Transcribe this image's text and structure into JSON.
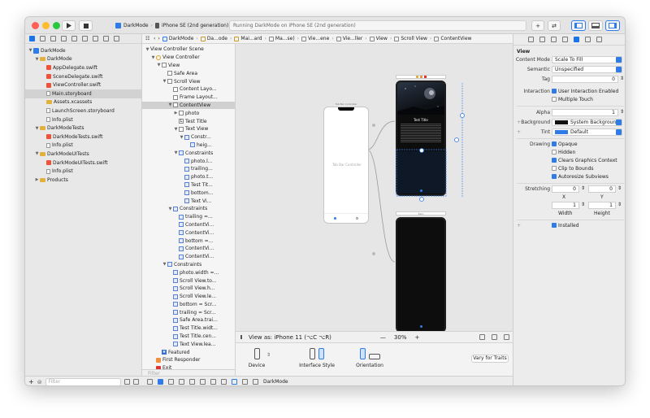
{
  "toolbar": {
    "scheme_name": "DarkMode",
    "destination": "iPhone SE (2nd generation)",
    "activity_text": "Running DarkMode on iPhone SE (2nd generation)",
    "run_icon": "play-icon",
    "stop_icon": "stop-icon",
    "traffic_light_colors": [
      "#ff5f57",
      "#febc2e",
      "#28c840"
    ]
  },
  "navigator": {
    "items": [
      {
        "label": "DarkMode",
        "kind": "project",
        "indent": 0,
        "disclosure": "open"
      },
      {
        "label": "DarkMode",
        "kind": "folder",
        "indent": 1,
        "disclosure": "open"
      },
      {
        "label": "AppDelegate.swift",
        "kind": "swift",
        "indent": 2
      },
      {
        "label": "SceneDelegate.swift",
        "kind": "swift",
        "indent": 2
      },
      {
        "label": "ViewController.swift",
        "kind": "swift",
        "indent": 2
      },
      {
        "label": "Main.storyboard",
        "kind": "file",
        "indent": 2,
        "selected": true
      },
      {
        "label": "Assets.xcassets",
        "kind": "folder",
        "indent": 2
      },
      {
        "label": "LaunchScreen.storyboard",
        "kind": "file",
        "indent": 2
      },
      {
        "label": "Info.plist",
        "kind": "file",
        "indent": 2
      },
      {
        "label": "DarkModeTests",
        "kind": "folder",
        "indent": 1,
        "disclosure": "open"
      },
      {
        "label": "DarkModeTests.swift",
        "kind": "swift",
        "indent": 2
      },
      {
        "label": "Info.plist",
        "kind": "file",
        "indent": 2
      },
      {
        "label": "DarkModeUITests",
        "kind": "folder",
        "indent": 1,
        "disclosure": "open"
      },
      {
        "label": "DarkModeUITests.swift",
        "kind": "swift",
        "indent": 2
      },
      {
        "label": "Info.plist",
        "kind": "file",
        "indent": 2
      },
      {
        "label": "Products",
        "kind": "folder",
        "indent": 1,
        "disclosure": "closed"
      }
    ],
    "filter_placeholder": "Filter"
  },
  "jumpbar": {
    "crumbs": [
      "DarkMode",
      "Da...ode",
      "Mai...ard",
      "Ma...se)",
      "Vie...ene",
      "Vie...ller",
      "View",
      "Scroll View",
      "ContentView"
    ]
  },
  "outline": {
    "rows": [
      {
        "label": "View Controller Scene",
        "icon": "none",
        "indent": 0,
        "disclosure": "open"
      },
      {
        "label": "View Controller",
        "icon": "vc",
        "indent": 1,
        "disclosure": "open"
      },
      {
        "label": "View",
        "icon": "box",
        "indent": 2,
        "disclosure": "open"
      },
      {
        "label": "Safe Area",
        "icon": "box",
        "indent": 3
      },
      {
        "label": "Scroll View",
        "icon": "box",
        "indent": 3,
        "disclosure": "open"
      },
      {
        "label": "Content Layo...",
        "icon": "box",
        "indent": 4
      },
      {
        "label": "Frame Layout...",
        "icon": "box",
        "indent": 4
      },
      {
        "label": "ContentView",
        "icon": "box",
        "indent": 4,
        "disclosure": "open",
        "selected": true
      },
      {
        "label": "photo",
        "icon": "box",
        "indent": 5,
        "disclosure": "closed"
      },
      {
        "label": "Test Title",
        "icon": "label",
        "indent": 5
      },
      {
        "label": "Text View",
        "icon": "box",
        "indent": 5,
        "disclosure": "open"
      },
      {
        "label": "Constr...",
        "icon": "con",
        "indent": 6,
        "disclosure": "open"
      },
      {
        "label": "heig...",
        "icon": "con",
        "indent": 7
      },
      {
        "label": "Constraints",
        "icon": "con",
        "indent": 5,
        "disclosure": "open"
      },
      {
        "label": "photo.l...",
        "icon": "con",
        "indent": 6
      },
      {
        "label": "trailing...",
        "icon": "con",
        "indent": 6
      },
      {
        "label": "photo.t...",
        "icon": "con",
        "indent": 6
      },
      {
        "label": "Test Tit...",
        "icon": "con",
        "indent": 6
      },
      {
        "label": "bottom...",
        "icon": "con",
        "indent": 6
      },
      {
        "label": "Text Vi...",
        "icon": "con",
        "indent": 6
      },
      {
        "label": "Constraints",
        "icon": "con",
        "indent": 4,
        "disclosure": "open"
      },
      {
        "label": "trailing =...",
        "icon": "con",
        "indent": 5
      },
      {
        "label": "ContentVi...",
        "icon": "con",
        "indent": 5
      },
      {
        "label": "ContentVi...",
        "icon": "con",
        "indent": 5
      },
      {
        "label": "bottom =...",
        "icon": "con",
        "indent": 5
      },
      {
        "label": "ContentVi...",
        "icon": "con",
        "indent": 5
      },
      {
        "label": "ContentVi...",
        "icon": "con",
        "indent": 5
      },
      {
        "label": "Constraints",
        "icon": "con",
        "indent": 3,
        "disclosure": "open"
      },
      {
        "label": "photo.width =...",
        "icon": "con",
        "indent": 4
      },
      {
        "label": "Scroll View.to...",
        "icon": "con",
        "indent": 4
      },
      {
        "label": "Scroll View.h...",
        "icon": "con",
        "indent": 4
      },
      {
        "label": "Scroll View.le...",
        "icon": "con",
        "indent": 4
      },
      {
        "label": "bottom = Scr...",
        "icon": "con",
        "indent": 4
      },
      {
        "label": "trailing = Scr...",
        "icon": "con",
        "indent": 4
      },
      {
        "label": "Safe Area.trai...",
        "icon": "con",
        "indent": 4
      },
      {
        "label": "Test Title.widt...",
        "icon": "con",
        "indent": 4
      },
      {
        "label": "Test Title.cen...",
        "icon": "con",
        "indent": 4
      },
      {
        "label": "Text View.lea...",
        "icon": "con",
        "indent": 4
      },
      {
        "label": "Featured",
        "icon": "star",
        "indent": 2
      },
      {
        "label": "First Responder",
        "icon": "first",
        "indent": 1
      },
      {
        "label": "Exit",
        "icon": "exit",
        "indent": 1
      }
    ],
    "filter_placeholder": "Filter"
  },
  "canvas": {
    "tabbar_label": "Tab Bar Controller",
    "tabbar_title": "Tab Bar Controller",
    "featured_title": "Test Title",
    "featured_header": "Featured",
    "second_header": "Item"
  },
  "zoom": {
    "view_as": "View as: iPhone 11 (⌥C ⌥R)",
    "zoom_level": "30%",
    "minus": "—",
    "plus": "+"
  },
  "device_bar": {
    "device_label": "Device",
    "interface_style_label": "Interface Style",
    "orientation_label": "Orientation",
    "vary_button": "Vary for Traits"
  },
  "bottom_bar": {
    "target": "DarkMode"
  },
  "inspector": {
    "section": "View",
    "content_mode_label": "Content Mode",
    "content_mode": "Scale To Fill",
    "semantic_label": "Semantic",
    "semantic": "Unspecified",
    "tag_label": "Tag",
    "tag": "0",
    "interaction_label": "Interaction",
    "user_interaction": "User Interaction Enabled",
    "multiple_touch": "Multiple Touch",
    "alpha_label": "Alpha",
    "alpha": "1",
    "background_label": "Background",
    "background": "System Backgroun...",
    "tint_label": "Tint",
    "tint": "Default",
    "drawing_label": "Drawing",
    "opaque": "Opaque",
    "hidden": "Hidden",
    "clears_graphics": "Clears Graphics Context",
    "clip_bounds": "Clip to Bounds",
    "autoresize": "Autoresize Subviews",
    "stretching_label": "Stretching",
    "stretch_x": "0",
    "stretch_y": "0",
    "x_label": "X",
    "y_label": "Y",
    "stretch_w": "1",
    "stretch_h": "1",
    "width_label": "Width",
    "height_label": "Height",
    "installed": "Installed"
  }
}
